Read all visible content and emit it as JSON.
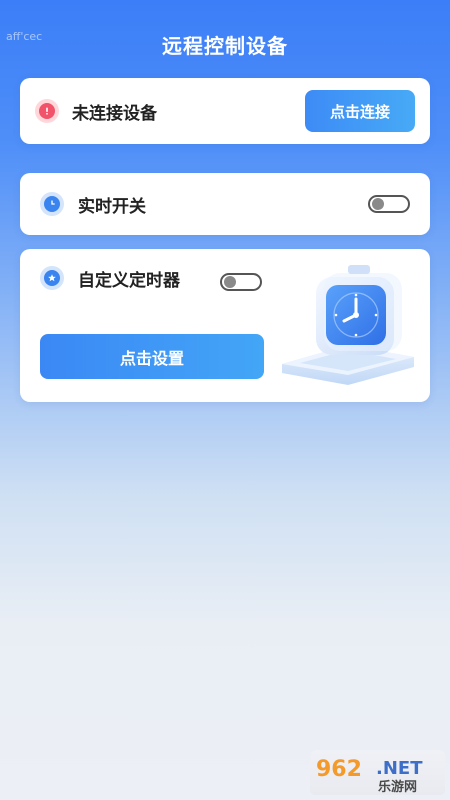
{
  "watermark": "aff'cec",
  "header": {
    "title": "远程控制设备"
  },
  "status_card": {
    "label": "未连接设备",
    "button_label": "点击连接",
    "icon": "alert-icon"
  },
  "realtime_card": {
    "label": "实时开关",
    "icon": "clock-icon",
    "toggle_on": false
  },
  "timer_card": {
    "label": "自定义定时器",
    "icon": "star-icon",
    "toggle_on": false,
    "button_label": "点击设置",
    "illustration": "alarm-clock-illustration"
  },
  "footer_logo": {
    "number": "962",
    "suffix": ".NET",
    "site": "乐游网"
  },
  "colors": {
    "accent": "#3d8bf6",
    "alert": "#f0536a",
    "background_top": "#3b7ef7",
    "background_bottom": "#eceff5"
  }
}
